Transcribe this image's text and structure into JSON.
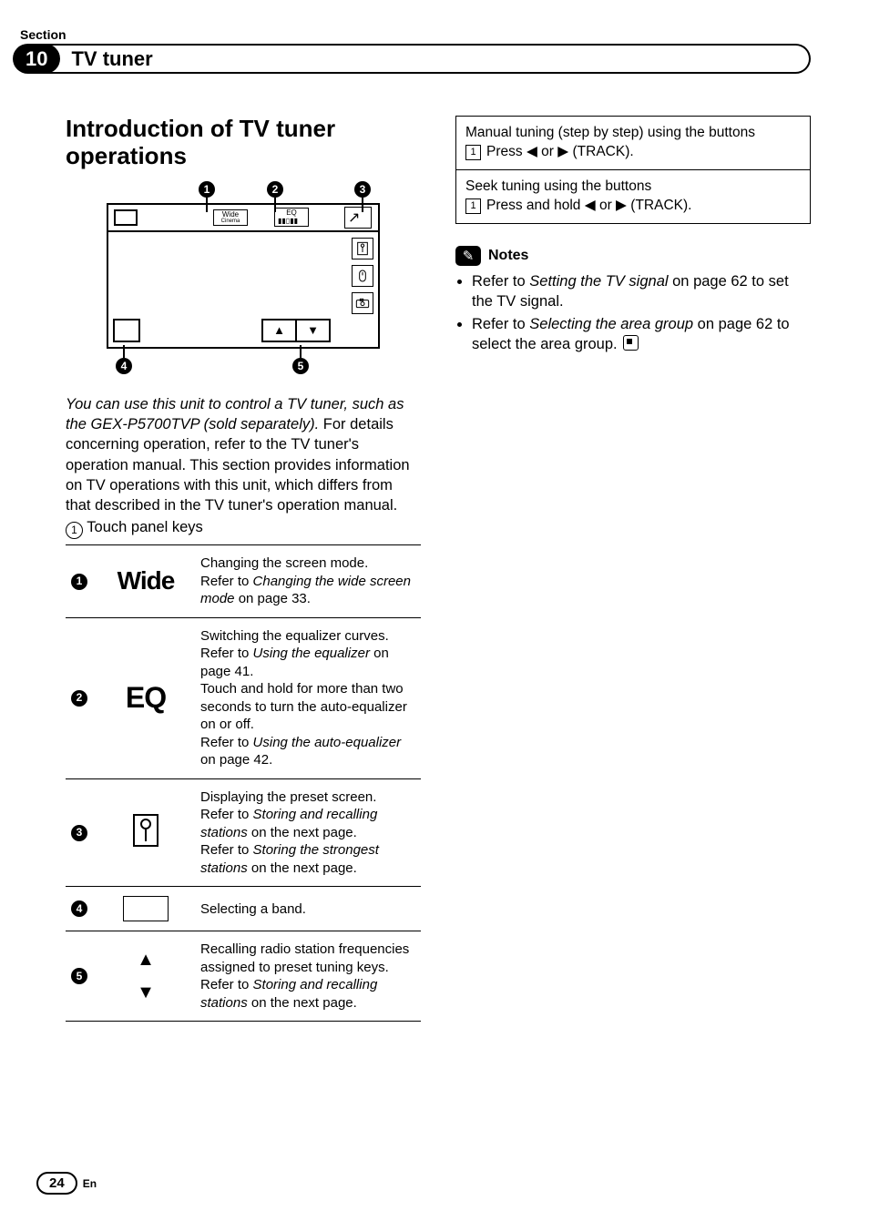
{
  "header": {
    "section_label": "Section",
    "chapter_number": "10",
    "chapter_title": "TV tuner"
  },
  "intro": {
    "title": "Introduction of TV tuner operations",
    "lead_italic": "You can use this unit to control a TV tuner, such as the GEX-P5700TVP (sold separately).",
    "body": "For details concerning operation, refer to the TV tuner's operation manual. This section provides information on TV operations with this unit, which differs from that described in the TV tuner's operation manual.",
    "touch_keys_label": "Touch panel keys"
  },
  "diagram_labels": {
    "wide_top": "Wide",
    "wide_bottom": "Cinema",
    "eq_top": "EQ"
  },
  "touch_table": [
    {
      "num": "1",
      "icon_kind": "wide",
      "icon_text": "Wide",
      "desc_pre": "Changing the screen mode.\nRefer to ",
      "desc_italic": "Changing the wide screen mode",
      "desc_post": " on page 33."
    },
    {
      "num": "2",
      "icon_kind": "eq",
      "icon_text": "EQ",
      "desc_pre": "Switching the equalizer curves.\nRefer to ",
      "desc_italic": "Using the equalizer",
      "desc_mid": " on page 41.\nTouch and hold for more than two seconds to turn the auto-equalizer on or off.\nRefer to ",
      "desc_italic2": "Using the auto-equalizer",
      "desc_post": " on page 42."
    },
    {
      "num": "3",
      "icon_kind": "list",
      "desc_pre": "Displaying the preset screen.\nRefer to ",
      "desc_italic": "Storing and recalling stations",
      "desc_mid": " on the next page.\nRefer to ",
      "desc_italic2": "Storing the strongest stations",
      "desc_post": " on the next page."
    },
    {
      "num": "4",
      "icon_kind": "band",
      "desc_pre": "Selecting a band."
    },
    {
      "num": "5",
      "icon_kind": "arrows",
      "desc_pre": "Recalling radio station frequencies assigned to preset tuning keys.\nRefer to ",
      "desc_italic": "Storing and recalling stations",
      "desc_post": " on the next page."
    }
  ],
  "right_box": {
    "row1_line1": "Manual tuning (step by step) using the buttons",
    "row1_line2_pre": "Press ",
    "row1_line2_mid": " or ",
    "row1_line2_post": " (",
    "row1_track": "TRACK",
    "row1_close": ").",
    "row2_line1": "Seek tuning using the buttons",
    "row2_line2_pre": "Press and hold ",
    "row2_line2_mid": " or ",
    "row2_line2_post": " (",
    "row2_track": "TRACK",
    "row2_close": ")."
  },
  "notes": {
    "title": "Notes",
    "items": [
      {
        "pre": "Refer to ",
        "italic": "Setting the TV signal",
        "post": " on page 62 to set the TV signal."
      },
      {
        "pre": "Refer to ",
        "italic": "Selecting the area group",
        "post": " on page 62 to select the area group."
      }
    ]
  },
  "footer": {
    "page": "24",
    "lang": "En"
  }
}
